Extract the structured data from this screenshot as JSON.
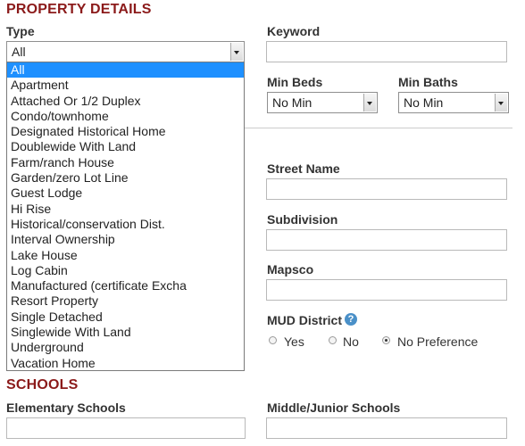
{
  "property_details": {
    "title": "PROPERTY DETAILS",
    "type_label": "Type",
    "type_selected": "All",
    "type_options": [
      "All",
      "Apartment",
      "Attached Or 1/2 Duplex",
      "Condo/townhome",
      "Designated Historical Home",
      "Doublewide With Land",
      "Farm/ranch House",
      "Garden/zero Lot Line",
      "Guest Lodge",
      "Hi Rise",
      "Historical/conservation Dist.",
      "Interval Ownership",
      "Lake House",
      "Log Cabin",
      "Manufactured (certificate Excha",
      "Resort Property",
      "Single Detached",
      "Singlewide With Land",
      "Underground",
      "Vacation Home"
    ],
    "keyword_label": "Keyword",
    "keyword_value": "",
    "min_beds_label": "Min Beds",
    "min_beds_value": "No Min",
    "min_baths_label": "Min Baths",
    "min_baths_value": "No Min",
    "street_name_label": "Street Name",
    "street_name_value": "",
    "subdivision_label": "Subdivision",
    "subdivision_value": "",
    "mapsco_label": "Mapsco",
    "mapsco_value": "",
    "mud_district_label": "MUD District",
    "help_icon_glyph": "?",
    "mud_options": [
      {
        "label": "Yes",
        "checked": false
      },
      {
        "label": "No",
        "checked": false
      },
      {
        "label": "No Preference",
        "checked": true
      }
    ]
  },
  "schools": {
    "title": "SCHOOLS",
    "elementary_label": "Elementary Schools",
    "elementary_value": "",
    "middle_label": "Middle/Junior Schools",
    "middle_value": ""
  },
  "colors": {
    "section_title": "#8b1a1a",
    "selected_option_bg": "#1e90ff",
    "help_icon": "#4a90c8"
  }
}
